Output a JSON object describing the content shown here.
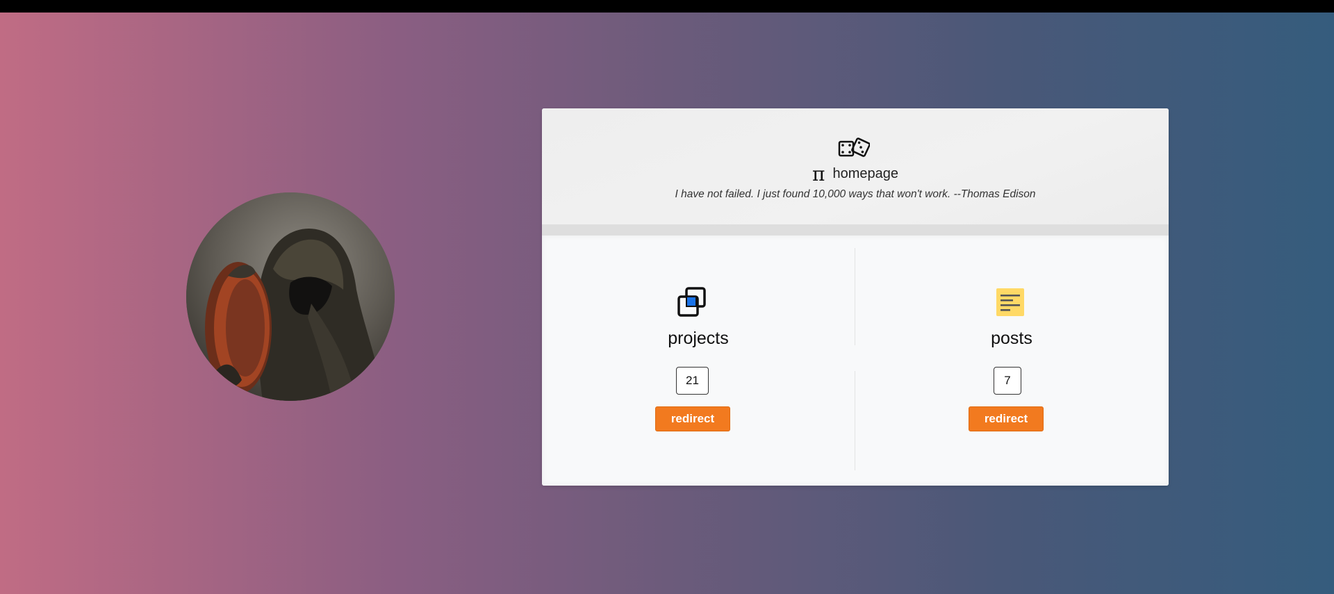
{
  "header": {
    "logo_icon": "dice-icon",
    "title_icon": "π",
    "title": "homepage",
    "quote": "I have not failed. I just found 10,000 ways that won't work. --Thomas Edison"
  },
  "sections": [
    {
      "icon": "projects-icon",
      "label": "projects",
      "count": "21",
      "button_label": "redirect"
    },
    {
      "icon": "posts-note-icon",
      "label": "posts",
      "count": "7",
      "button_label": "redirect"
    }
  ],
  "colors": {
    "background_left": "#c06c84",
    "background_right": "#355c7d",
    "accent_button": "#f27a1f",
    "projects_icon_accent": "#1a73e8",
    "note_icon": "#ffd966"
  }
}
